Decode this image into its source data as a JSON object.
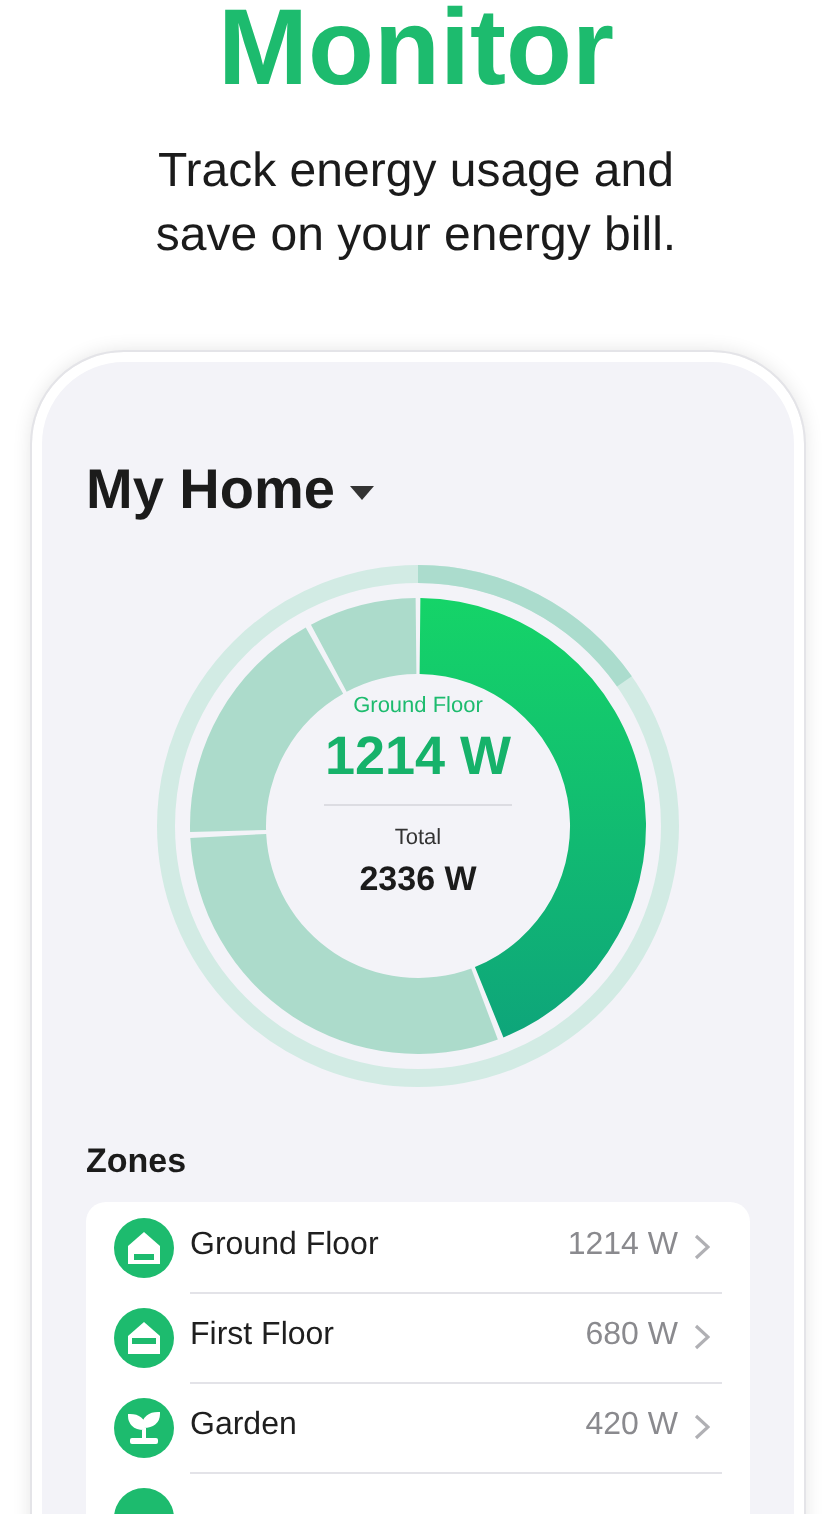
{
  "headline": "Monitor",
  "subtitle": "Track energy usage and save on your energy bill.",
  "home": {
    "title": "My Home"
  },
  "donut_center": {
    "zone_label": "Ground Floor",
    "zone_value": "1214 W",
    "total_label": "Total",
    "total_value": "2336 W"
  },
  "zones": {
    "heading": "Zones",
    "items": [
      {
        "kind": "house",
        "name": "Ground Floor",
        "reading": "1214 W"
      },
      {
        "kind": "house-mid",
        "name": "First Floor",
        "reading": "680 W"
      },
      {
        "kind": "plant",
        "name": "Garden",
        "reading": "420 W"
      },
      {
        "kind": "hidden"
      }
    ]
  }
}
